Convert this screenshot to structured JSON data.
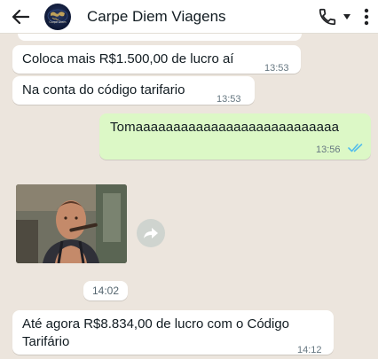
{
  "header": {
    "contact_name": "Carpe Diem Viagens",
    "back_icon": "arrow-left-icon",
    "call_icon": "phone-icon",
    "call_dropdown_icon": "caret-down-icon",
    "menu_icon": "more-vertical-icon",
    "avatar_logo_text": "Carpe Diem"
  },
  "messages": [
    {
      "direction": "in",
      "text": "Coloca mais R$1.500,00 de lucro aí",
      "time": "13:53"
    },
    {
      "direction": "in",
      "text": "Na conta do código tarifario",
      "time": "13:53"
    },
    {
      "direction": "out",
      "text": "Tomaaaaaaaaaaaaaaaaaaaaaaaaaaa",
      "time": "13:56",
      "status": "read"
    },
    {
      "direction": "in",
      "type": "gif",
      "forward_icon": "forward-icon"
    },
    {
      "direction": "in",
      "type": "time-chip",
      "time": "14:02"
    },
    {
      "direction": "in",
      "text": "Até agora R$8.834,00 de lucro com o Código Tarifário",
      "time": "14:12"
    }
  ],
  "colors": {
    "chat_background": "#ece5dd",
    "incoming_bubble": "#ffffff",
    "outgoing_bubble": "#dcf8c6",
    "read_ticks": "#53bdeb"
  }
}
